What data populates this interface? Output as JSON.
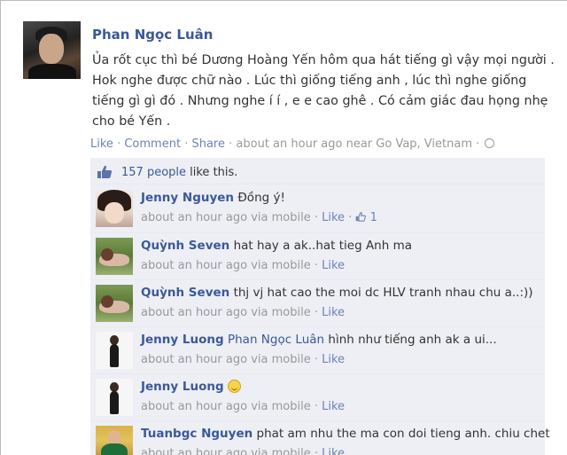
{
  "post": {
    "author": "Phan Ngọc Luân",
    "message_lines": [
      "Ủa rốt cục thì bé Dương Hoàng Yến hôm qua hát tiếng gì vậy mọi người .",
      "Hok nghe được chữ nào . Lúc thì giống tiếng anh , lúc thì nghe giống",
      "tiếng gì gì đó . Nhưng nghe í í , e e cao ghê . Có cảm giác đau họng nhẹ",
      "cho bé Yến ."
    ],
    "actions": {
      "like": "Like",
      "comment": "Comment",
      "share": "Share",
      "sep": "·",
      "time_location": "about an hour ago near Go Vap, Vietnam"
    },
    "likes": {
      "count_link": "157 people",
      "suffix": " like this."
    }
  },
  "comments": [
    {
      "name": "Jenny Nguyen",
      "text": "Đồng ý!",
      "meta": "about an hour ago via mobile",
      "like": "Like",
      "like_count": "1",
      "avatar": "female-portrait"
    },
    {
      "name": "Quỳnh Seven",
      "text": "hat hay a ak..hat tieg Anh ma",
      "meta": "about an hour ago via mobile",
      "like": "Like",
      "avatar": "lying-figure-on-grass"
    },
    {
      "name": "Quỳnh Seven",
      "text": "thj vj hat cao the moi dc HLV tranh nhau chu a..:))",
      "meta": "about an hour ago via mobile",
      "like": "Like",
      "avatar": "lying-figure-on-grass"
    },
    {
      "name": "Jenny Luong",
      "mention": "Phan Ngọc Luân",
      "text": " hình như tiếng anh ak a ui...",
      "meta": "about an hour ago via mobile",
      "like": "Like",
      "avatar": "standing-figure"
    },
    {
      "name": "Jenny Luong",
      "text": "",
      "meta": "about an hour ago via mobile",
      "like": "Like",
      "avatar": "standing-figure",
      "emoticon": "smiley-icon"
    },
    {
      "name": "Tuanbgc Nguyen",
      "text": "phat am nhu the ma con doi tieng anh. chiu chet",
      "meta": "about an hour ago via mobile",
      "like": "Like",
      "avatar": "man-in-green-shirt"
    }
  ],
  "colors": {
    "link": "#3b5998",
    "muted_link": "#6d84b4",
    "meta_text": "#999999",
    "ufi_background": "#edeff4"
  }
}
